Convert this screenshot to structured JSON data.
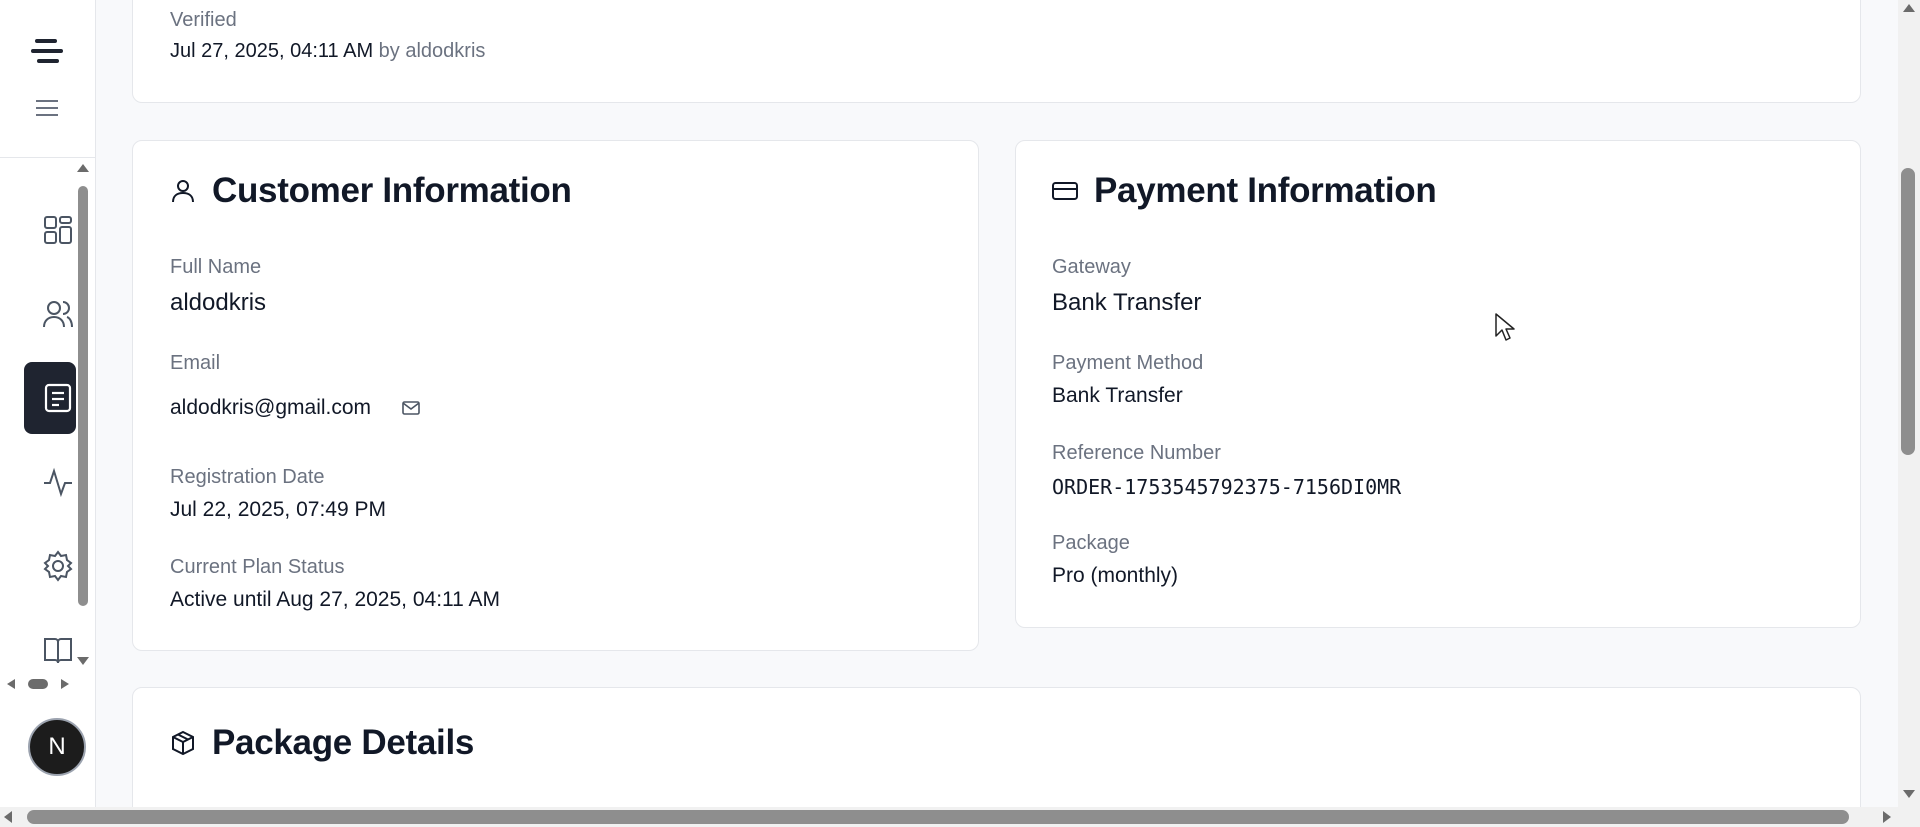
{
  "sidebar": {
    "nav_items": [
      {
        "icon": "dashboard-icon"
      },
      {
        "icon": "users-icon"
      },
      {
        "icon": "receipt-icon",
        "active": true
      },
      {
        "icon": "activity-icon"
      },
      {
        "icon": "settings-icon"
      },
      {
        "icon": "book-icon"
      }
    ],
    "avatar_initial": "N"
  },
  "verification": {
    "label": "Verified",
    "date": "Jul 27, 2025, 04:11 AM",
    "by": "by aldodkris"
  },
  "customer": {
    "title": "Customer Information",
    "full_name_label": "Full Name",
    "full_name": "aldodkris",
    "email_label": "Email",
    "email": "aldodkris@gmail.com",
    "registration_label": "Registration Date",
    "registration_date": "Jul 22, 2025, 07:49 PM",
    "plan_status_label": "Current Plan Status",
    "plan_status": "Active until Aug 27, 2025, 04:11 AM"
  },
  "payment": {
    "title": "Payment Information",
    "gateway_label": "Gateway",
    "gateway": "Bank Transfer",
    "method_label": "Payment Method",
    "method": "Bank Transfer",
    "reference_label": "Reference Number",
    "reference": "ORDER-1753545792375-7156DI0MR",
    "package_label": "Package",
    "package": "Pro (monthly)"
  },
  "package_details": {
    "title": "Package Details"
  },
  "colors": {
    "background": "#f8f9fb",
    "card": "#ffffff",
    "active_nav": "#1f2430",
    "text": "#111827",
    "muted": "#6b7280"
  }
}
